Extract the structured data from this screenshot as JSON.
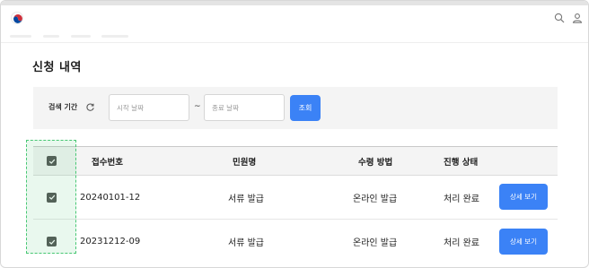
{
  "header": {
    "logo_icon": "taegeuk-logo-icon",
    "search_icon": "search-icon",
    "user_icon": "user-icon"
  },
  "page": {
    "title": "신청 내역"
  },
  "search": {
    "label": "검색 기간",
    "refresh_icon": "refresh-icon",
    "start_placeholder": "시작 날짜",
    "end_placeholder": "종료 날짜",
    "separator": "~",
    "button_label": "조회"
  },
  "table": {
    "columns": [
      "접수번호",
      "민원명",
      "수령 방법",
      "진행 상태"
    ],
    "select_all_checked": true,
    "rows": [
      {
        "checked": true,
        "receipt_no": "20240101-12",
        "civil_name": "서류 발급",
        "receive_method": "온라인 발급",
        "status": "처리 완료",
        "action_label": "상세 보기"
      },
      {
        "checked": true,
        "receipt_no": "20231212-09",
        "civil_name": "서류 발급",
        "receive_method": "온라인 발급",
        "status": "처리 완료",
        "action_label": "상세 보기"
      }
    ]
  },
  "colors": {
    "accent": "#3b82f6",
    "highlight": "#48c774",
    "checkbox": "#555555"
  }
}
